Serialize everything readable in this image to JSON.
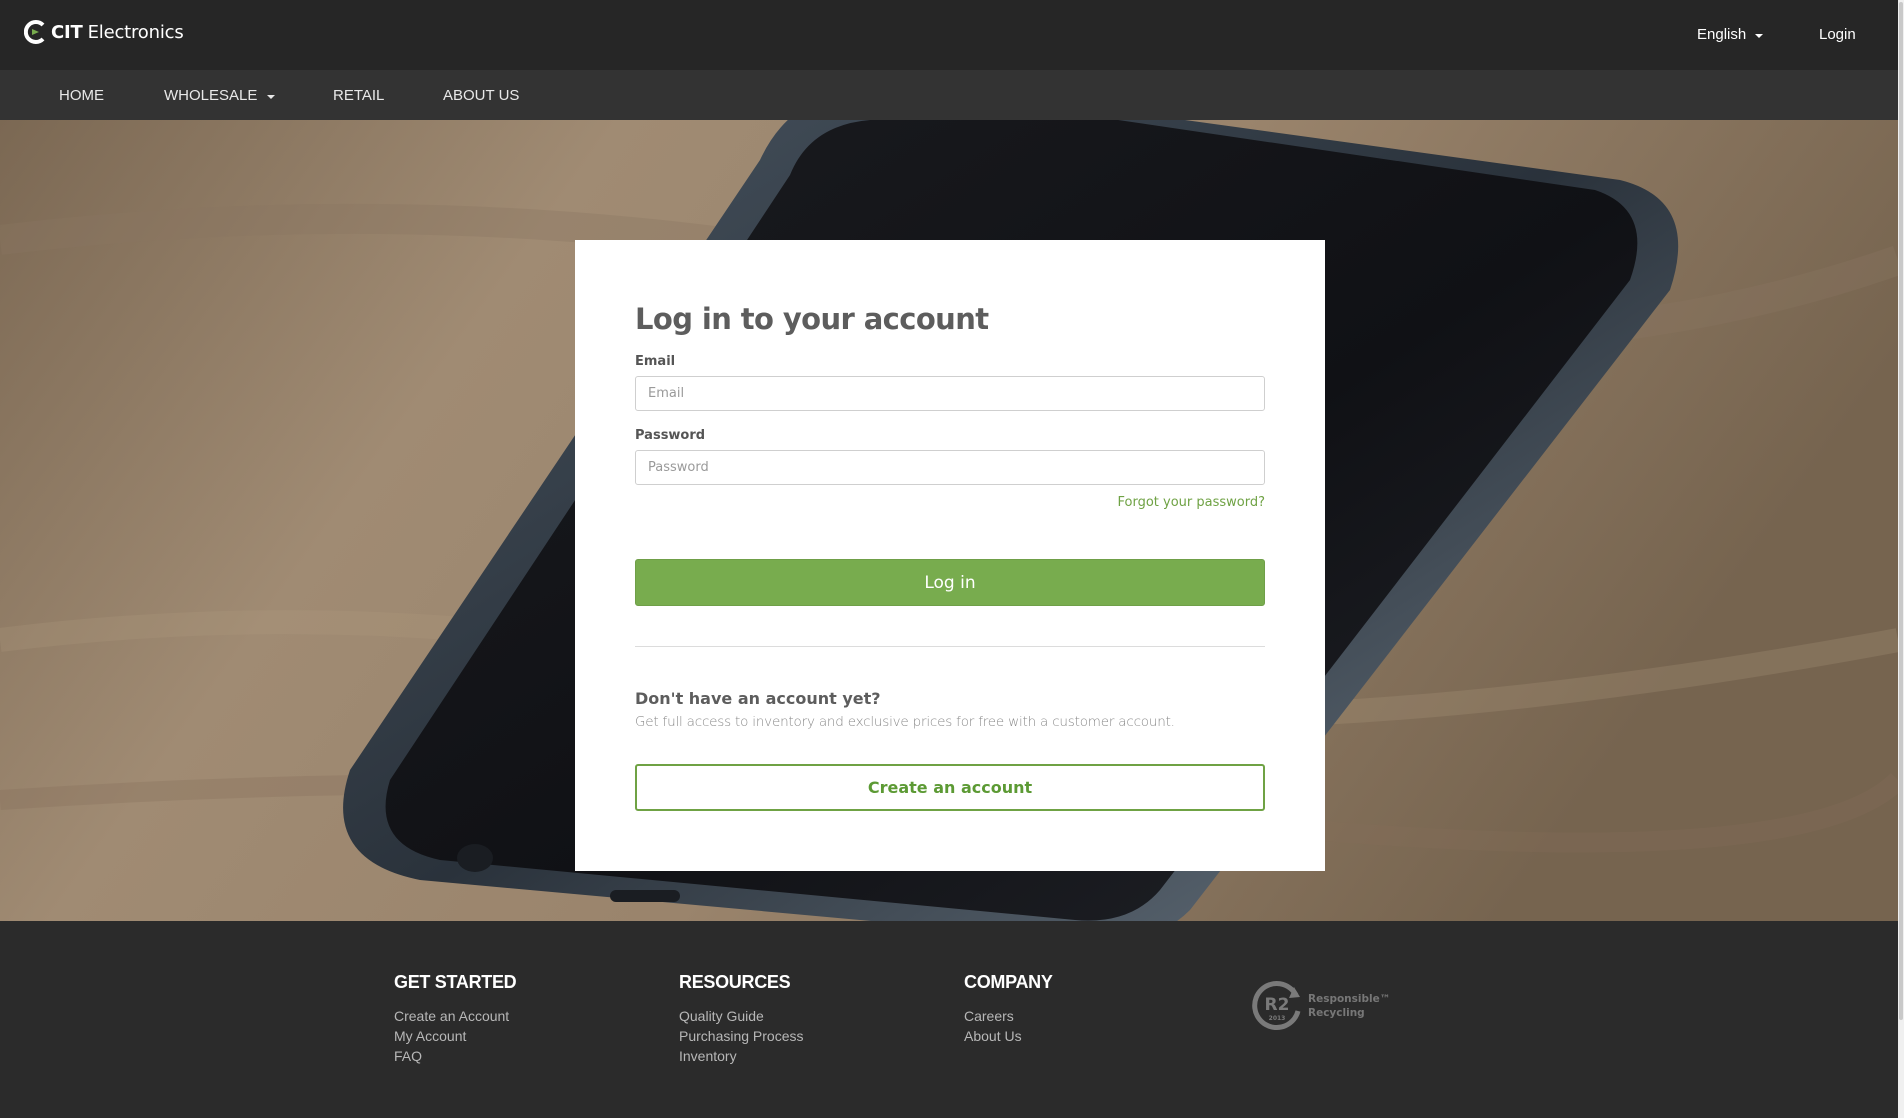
{
  "header": {
    "logo_bold": "CIT",
    "logo_text": "Electronics",
    "language": "English",
    "login_label": "Login"
  },
  "nav": {
    "items": [
      {
        "label": "HOME"
      },
      {
        "label": "WHOLESALE",
        "has_dropdown": true
      },
      {
        "label": "RETAIL"
      },
      {
        "label": "ABOUT US"
      }
    ]
  },
  "login_form": {
    "title": "Log in to your account",
    "email_label": "Email",
    "email_placeholder": "Email",
    "email_value": "",
    "password_label": "Password",
    "password_placeholder": "Password",
    "password_value": "",
    "forgot_label": "Forgot your password?",
    "submit_label": "Log in"
  },
  "signup": {
    "title": "Don't have an account yet?",
    "text": "Get full access to inventory and exclusive prices for free with a customer account.",
    "button_label": "Create an account"
  },
  "footer": {
    "columns": [
      {
        "heading": "GET STARTED",
        "links": [
          "Create an Account",
          "My Account",
          "FAQ"
        ]
      },
      {
        "heading": "RESOURCES",
        "links": [
          "Quality Guide",
          "Purchasing Process",
          "Inventory"
        ]
      },
      {
        "heading": "COMPANY",
        "links": [
          "Careers",
          "About Us"
        ]
      }
    ],
    "badge": {
      "mark": "R2",
      "year": "2013",
      "line1": "Responsible™",
      "line2": "Recycling"
    }
  },
  "colors": {
    "accent": "#78ac4e",
    "topbar": "#262626",
    "navbar": "#333333",
    "footer": "#2b2b2b"
  },
  "icons": {
    "logo": "cit-logo-icon",
    "language_caret": "chevron-down-icon",
    "wholesale_caret": "chevron-down-icon",
    "badge": "r2-recycling-logo-icon"
  }
}
